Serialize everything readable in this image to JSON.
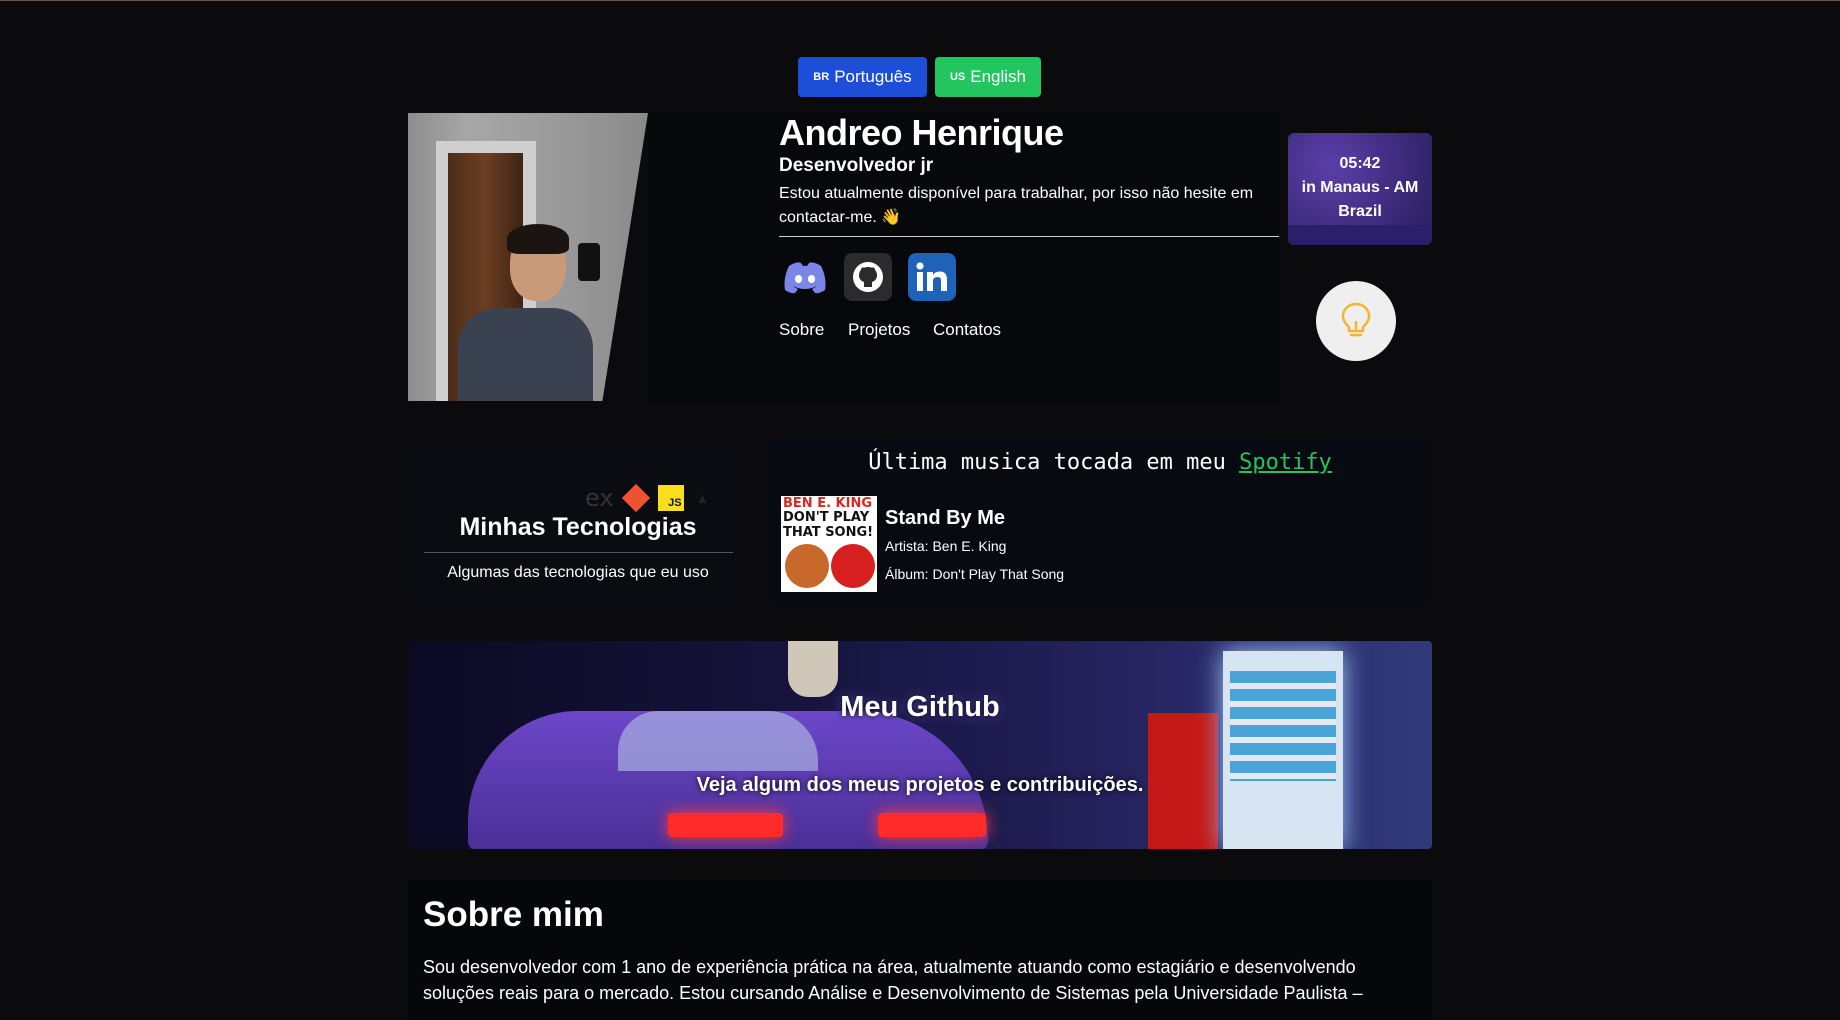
{
  "lang": {
    "pt": {
      "flag": "BR",
      "label": "Português"
    },
    "en": {
      "flag": "US",
      "label": "English"
    }
  },
  "profile": {
    "name": "Andreo Henrique",
    "role": "Desenvolvedor jr",
    "description": "Estou atualmente disponível para trabalhar, por isso não hesite em contactar-me. 👋",
    "nav": [
      "Sobre",
      "Projetos",
      "Contatos"
    ]
  },
  "clock": {
    "time": "05:42",
    "location_line1": "in Manaus - AM",
    "location_line2": "Brazil"
  },
  "technologies": {
    "title": "Minhas Tecnologias",
    "subtitle": "Algumas das tecnologias que eu uso",
    "icons": [
      "express-icon",
      "git-icon",
      "javascript-icon",
      "nextjs-icon"
    ]
  },
  "spotify": {
    "heading": "Última musica tocada em meu",
    "link": "Spotify",
    "album_cover_text_1": "BEN E. KING",
    "album_cover_text_2": "DON'T PLAY THAT SONG!",
    "song": "Stand By Me",
    "artist": "Artista: Ben E. King",
    "album": "Álbum: Don't Play That Song"
  },
  "github_banner": {
    "title": "Meu Github",
    "subtitle": "Veja algum dos meus projetos e contribuições."
  },
  "about": {
    "title": "Sobre mim",
    "text": "Sou desenvolvedor com 1 ano de experiência prática na área, atualmente atuando como estagiário e desenvolvendo soluções reais para o mercado. Estou cursando Análise e Desenvolvimento de Sistemas pela Universidade Paulista –"
  },
  "colors": {
    "background": "#0b0b0d",
    "pt_button": "#1d4ed8",
    "en_button": "#22c55e",
    "spotify_green": "#22c55e",
    "linkedin_blue": "#1e63b7",
    "clock_purple": "#3b2a7a"
  }
}
